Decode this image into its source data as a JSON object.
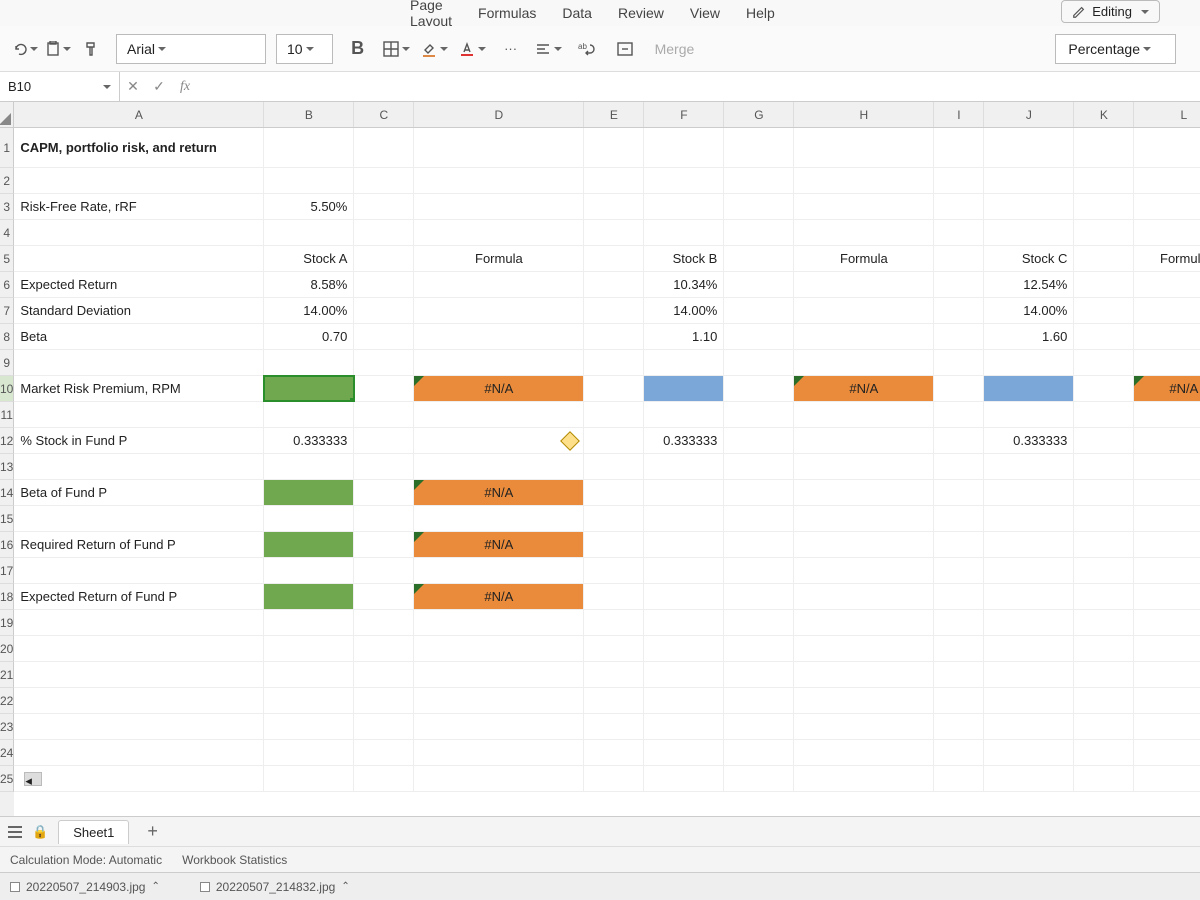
{
  "ribbon": {
    "tabs": [
      "Page Layout",
      "Formulas",
      "Data",
      "Review",
      "View",
      "Help"
    ],
    "editing_label": "Editing"
  },
  "toolbar": {
    "font_name": "Arial",
    "font_size": "10",
    "bold": "B",
    "merge_label": "Merge",
    "number_format": "Percentage"
  },
  "formula_bar": {
    "cell_ref": "B10",
    "fx": "fx"
  },
  "columns": [
    "A",
    "B",
    "C",
    "D",
    "E",
    "F",
    "G",
    "H",
    "I",
    "J",
    "K",
    "L"
  ],
  "row_numbers": [
    "1",
    "2",
    "3",
    "4",
    "5",
    "6",
    "7",
    "8",
    "9",
    "10",
    "11",
    "12",
    "13",
    "14",
    "15",
    "16",
    "17",
    "18",
    "19",
    "20",
    "21",
    "22",
    "23",
    "24",
    "25"
  ],
  "cells": {
    "A1": "CAPM, portfolio risk, and return",
    "A3": "Risk-Free Rate, rRF",
    "B3": "5.50%",
    "B5": "Stock A",
    "D5": "Formula",
    "F5": "Stock B",
    "H5": "Formula",
    "J5": "Stock C",
    "L5": "Formula",
    "A6": "Expected Return",
    "B6": "8.58%",
    "F6": "10.34%",
    "J6": "12.54%",
    "A7": "Standard Deviation",
    "B7": "14.00%",
    "F7": "14.00%",
    "J7": "14.00%",
    "A8": "Beta",
    "B8": "0.70",
    "F8": "1.10",
    "J8": "1.60",
    "A10": "Market Risk Premium, RPM",
    "D10": "#N/A",
    "H10": "#N/A",
    "L10": "#N/A",
    "A12": "% Stock in Fund P",
    "B12": "0.333333",
    "F12": "0.333333",
    "J12": "0.333333",
    "A14": "Beta of Fund P",
    "D14": "#N/A",
    "A16": "Required Return of Fund P",
    "D16": "#N/A",
    "A18": "Expected Return of Fund P",
    "D18": "#N/A"
  },
  "sheet_tabs": {
    "active": "Sheet1"
  },
  "status_bar": {
    "calc": "Calculation Mode: Automatic",
    "stats": "Workbook Statistics"
  },
  "taskbar": {
    "file1": "20220507_214903.jpg",
    "file2": "20220507_214832.jpg"
  }
}
